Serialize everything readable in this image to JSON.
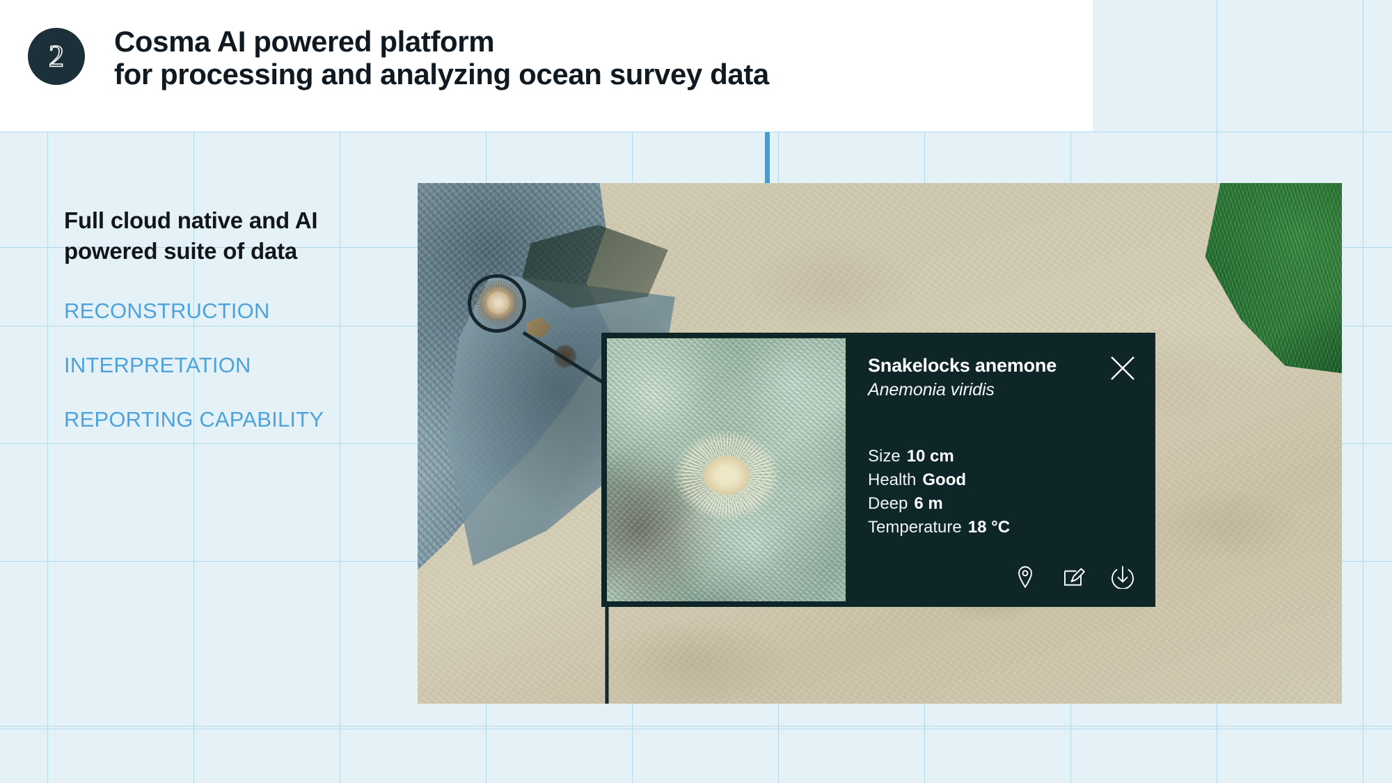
{
  "header": {
    "step_number": "2",
    "title": "Cosma AI powered platform\nfor processing and analyzing ocean survey data"
  },
  "left_column": {
    "intro": "Full cloud native and AI\npowered suite of data",
    "capabilities": [
      {
        "label": "RECONSTRUCTION"
      },
      {
        "label": "INTERPRETATION"
      },
      {
        "label": "REPORTING CAPABILITY"
      }
    ]
  },
  "info_card": {
    "common_name": "Snakelocks anemone",
    "scientific_name": "Anemonia viridis",
    "attributes": [
      {
        "label": "Size",
        "value": "10 cm"
      },
      {
        "label": "Health",
        "value": "Good"
      },
      {
        "label": "Deep",
        "value": "6 m"
      },
      {
        "label": "Temperature",
        "value": "18 °C"
      }
    ],
    "close_icon": "close-icon",
    "actions": [
      {
        "icon": "location-pin-icon"
      },
      {
        "icon": "edit-icon"
      },
      {
        "icon": "download-icon"
      }
    ]
  },
  "colors": {
    "page_background": "#e4f1f7",
    "grid_line": "#a9d3ea",
    "accent_blue": "#3da1d8",
    "capability_text": "#4da3da",
    "dark_navy": "#1b3038",
    "card_background": "#0f2629",
    "header_panel": "#ffffff",
    "title_text": "#101820"
  }
}
